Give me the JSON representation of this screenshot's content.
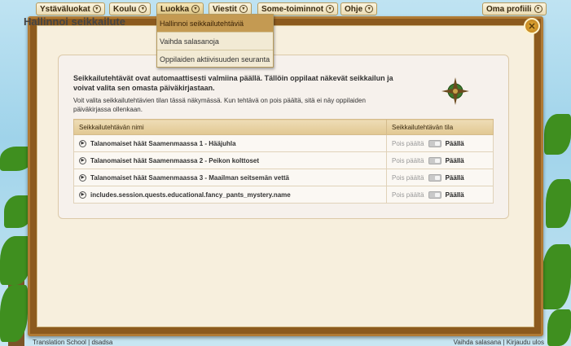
{
  "nav": {
    "items": [
      {
        "label": "Ystäväluokat"
      },
      {
        "label": "Koulu"
      },
      {
        "label": "Luokka"
      },
      {
        "label": "Viestit"
      },
      {
        "label": "Some-toiminnot"
      },
      {
        "label": "Ohje"
      },
      {
        "label": "Oma profiili"
      }
    ],
    "chevron": "▾"
  },
  "dropdown": {
    "items": [
      {
        "label": "Hallinnoi seikkailutehtäviä"
      },
      {
        "label": "Vaihda salasanoja"
      },
      {
        "label": "Oppilaiden aktiivisuuden seuranta"
      }
    ]
  },
  "page": {
    "title": "Hallinnoi seikkailute",
    "close_glyph": "✕"
  },
  "intro": {
    "bold": "Seikkailutehtävät ovat automaattisesti valmiina päällä. Tällöin oppilaat näkevät seikkailun ja voivat valita sen omasta päiväkirjastaan.",
    "normal": "Voit valita seikkailutehtävien tilan tässä näkymässä. Kun tehtävä on pois päältä, sitä ei näy oppilaiden päiväkirjassa ollenkaan."
  },
  "table": {
    "headers": [
      "Seikkailutehtävän nimi",
      "Seikkailutehtävän tila"
    ],
    "off_label": "Pois päältä",
    "on_label": "Päällä",
    "rows": [
      {
        "name": "Talanomaiset häät Saamenmaassa 1 - Hääjuhla"
      },
      {
        "name": "Talanomaiset häät Saamenmaassa 2 - Peikon kolttoset"
      },
      {
        "name": "Talanomaiset häät Saamenmaassa 3 - Maailman seitsemän vettä"
      },
      {
        "name": "includes.session.quests.educational.fancy_pants_mystery.name"
      }
    ]
  },
  "footer": {
    "left": "Translation School | dsadsa",
    "right": "Vaihda salasana | Kirjaudu ulos"
  },
  "colors": {
    "frame": "#8c5a1e",
    "panel": "#f6f1ec",
    "header": "#e1c892",
    "dropdown_hover": "#c49a52"
  }
}
